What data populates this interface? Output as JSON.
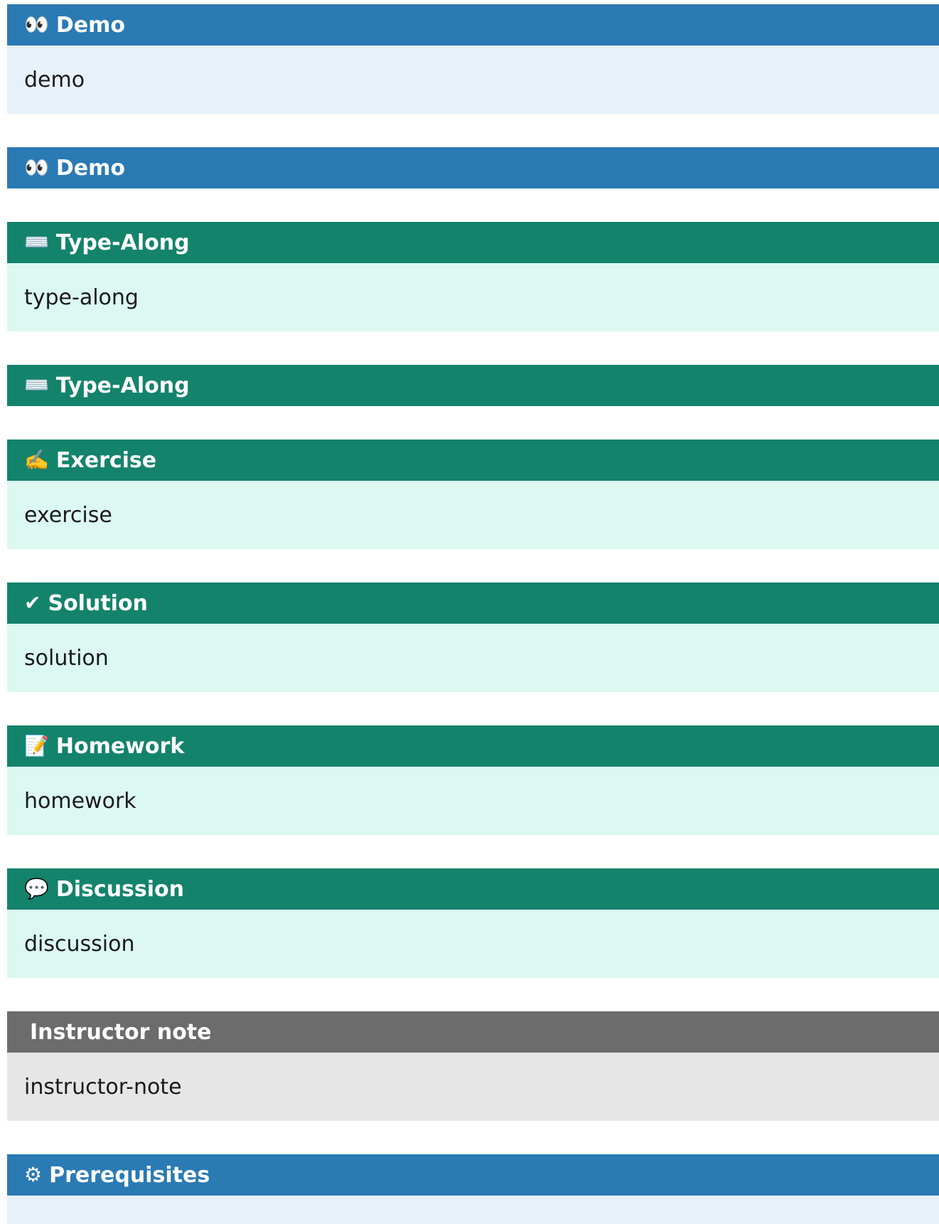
{
  "colors": {
    "blue_title": "#2a7ab4",
    "blue_body": "#e7f1fa",
    "green_title": "#14836c",
    "green_body": "#dbf8f1",
    "gray_title": "#6c6c6c",
    "gray_body": "#e6e6e6"
  },
  "admonitions": [
    {
      "icon": "👀",
      "icon_name": "eyes-icon",
      "title": "Demo",
      "body": "demo"
    },
    {
      "icon": "👀",
      "icon_name": "eyes-icon",
      "title": "Demo",
      "body": ""
    },
    {
      "icon": "⌨️",
      "icon_name": "keyboard-icon",
      "title": "Type-Along",
      "body": "type-along"
    },
    {
      "icon": "⌨️",
      "icon_name": "keyboard-icon",
      "title": "Type-Along",
      "body": ""
    },
    {
      "icon": "✍️",
      "icon_name": "writing-hand-icon",
      "title": "Exercise",
      "body": "exercise"
    },
    {
      "icon": "✔",
      "icon_name": "check-icon",
      "title": "Solution",
      "body": "solution"
    },
    {
      "icon": "📝",
      "icon_name": "memo-icon",
      "title": "Homework",
      "body": "homework"
    },
    {
      "icon": "💬",
      "icon_name": "speech-bubble-icon",
      "title": "Discussion",
      "body": "discussion"
    },
    {
      "icon": "",
      "icon_name": "",
      "title": "Instructor note",
      "body": "instructor-note"
    },
    {
      "icon": "⚙",
      "icon_name": "gear-icon",
      "title": "Prerequisites",
      "body": ""
    }
  ]
}
